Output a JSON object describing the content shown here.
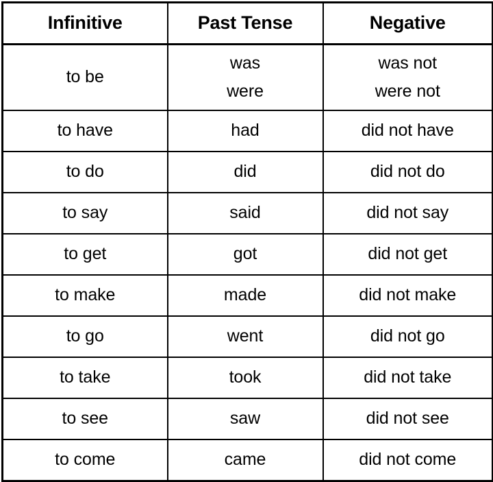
{
  "table": {
    "headers": [
      "Infinitive",
      "Past Tense",
      "Negative"
    ],
    "rows": [
      {
        "infinitive": "to be",
        "past_lines": [
          "was",
          "were"
        ],
        "negative_lines": [
          "was not",
          "were not"
        ],
        "tall": true
      },
      {
        "infinitive": "to have",
        "past_lines": [
          "had"
        ],
        "negative_lines": [
          "did not have"
        ],
        "tall": false
      },
      {
        "infinitive": "to do",
        "past_lines": [
          "did"
        ],
        "negative_lines": [
          "did not do"
        ],
        "tall": false
      },
      {
        "infinitive": "to say",
        "past_lines": [
          "said"
        ],
        "negative_lines": [
          "did not say"
        ],
        "tall": false
      },
      {
        "infinitive": "to get",
        "past_lines": [
          "got"
        ],
        "negative_lines": [
          "did not get"
        ],
        "tall": false
      },
      {
        "infinitive": "to make",
        "past_lines": [
          "made"
        ],
        "negative_lines": [
          "did not make"
        ],
        "tall": false
      },
      {
        "infinitive": "to go",
        "past_lines": [
          "went"
        ],
        "negative_lines": [
          "did not go"
        ],
        "tall": false
      },
      {
        "infinitive": "to take",
        "past_lines": [
          "took"
        ],
        "negative_lines": [
          "did not take"
        ],
        "tall": false
      },
      {
        "infinitive": "to see",
        "past_lines": [
          "saw"
        ],
        "negative_lines": [
          "did not see"
        ],
        "tall": false
      },
      {
        "infinitive": "to come",
        "past_lines": [
          "came"
        ],
        "negative_lines": [
          "did not come"
        ],
        "tall": false
      }
    ],
    "colors": {
      "text": "#000000",
      "border": "#000000",
      "background": "#ffffff"
    }
  }
}
